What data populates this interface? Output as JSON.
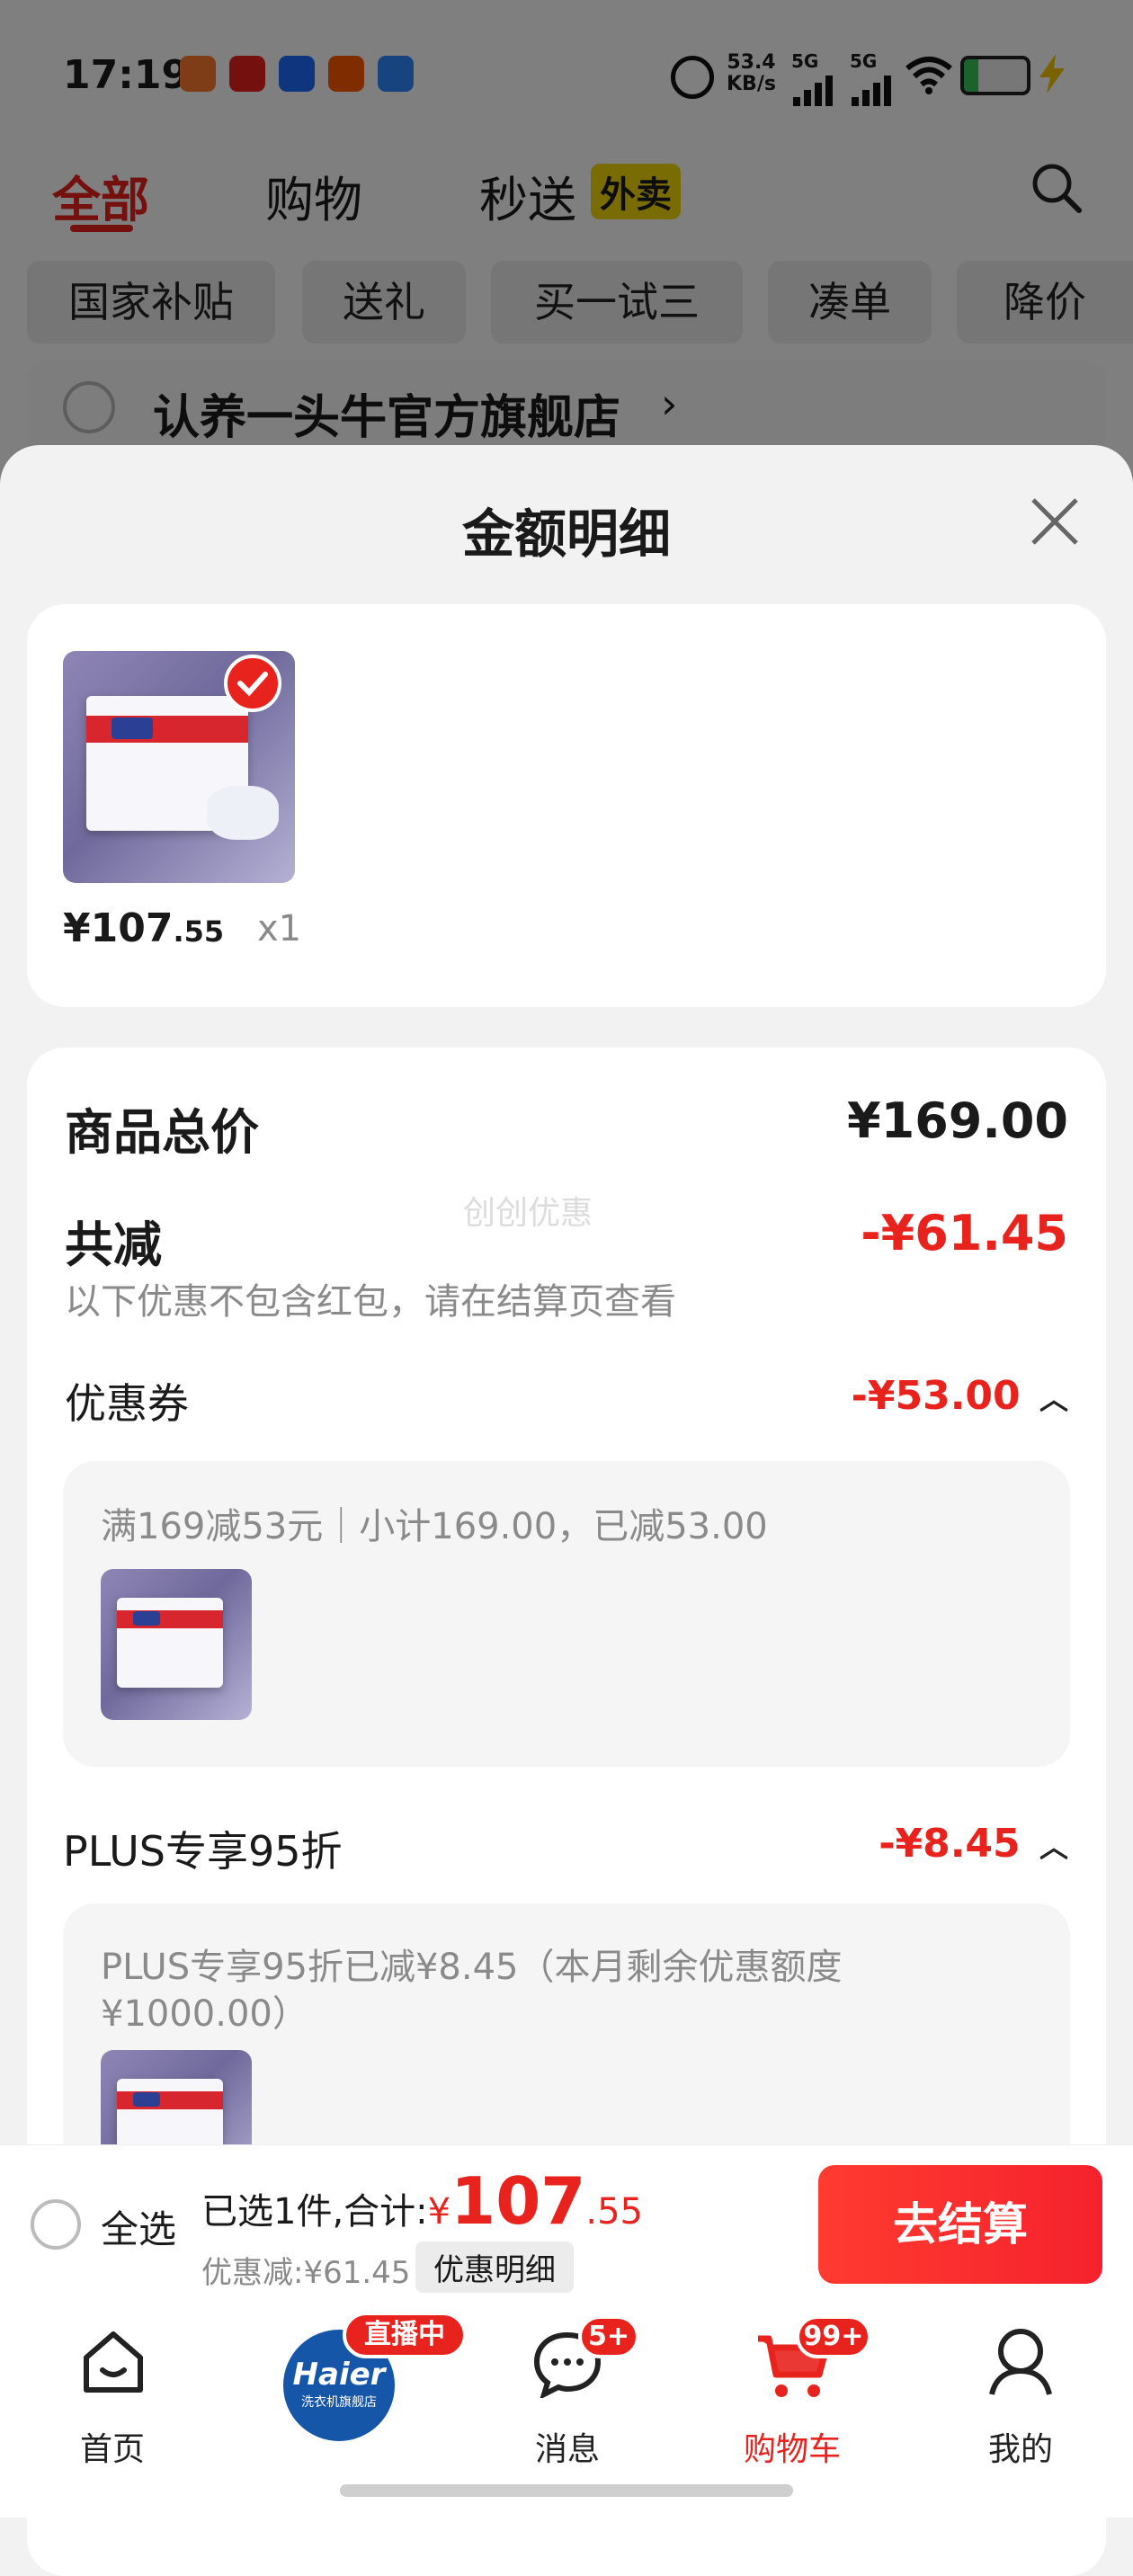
{
  "status_bar": {
    "time": "17:19",
    "net_speed_value": "53.4",
    "net_speed_unit": "KB/s",
    "signal1": "5G",
    "signal2": "5G"
  },
  "top_tabs": [
    {
      "label": "全部"
    },
    {
      "label": "购物"
    },
    {
      "label": "秒送"
    }
  ],
  "takeout_badge": "外卖",
  "filter_chips": [
    "国家补贴",
    "送礼",
    "买一试三",
    "凑单",
    "降价"
  ],
  "store": {
    "name": "认养一头牛官方旗舰店",
    "arrow": "›"
  },
  "sheet": {
    "title": "金额明细",
    "item": {
      "price_main": "¥107",
      "price_dec": ".55",
      "qty": "x1"
    },
    "total_label": "商品总价",
    "total_value": "¥169.00",
    "reduce_label": "共减",
    "reduce_value": "-¥61.45",
    "watermark": "创创优惠",
    "note": "以下优惠不包含红包，请在结算页查看",
    "coupon_label": "优惠券",
    "coupon_value": "-¥53.00",
    "coupon_detail": "满169减53元｜小计169.00，已减53.00",
    "plus_label": "PLUS专享95折",
    "plus_value": "-¥8.45",
    "plus_detail_line1": "PLUS专享95折已减¥8.45（本月剩余优惠额度",
    "plus_detail_line2": "¥1000.00）"
  },
  "checkout": {
    "select_all": "全选",
    "selected_text": "已选1件,合计:",
    "currency": "¥",
    "amount_main": "107",
    "amount_dec": ".55",
    "discount_text": "优惠减:¥61.45",
    "detail_button": "优惠明细",
    "checkout_button": "去结算"
  },
  "bottom_nav": {
    "home": "首页",
    "live_badge": "直播中",
    "live_brand": "Haier",
    "live_sub": "洗衣机旗舰店",
    "messages": "消息",
    "messages_badge": "5+",
    "cart": "购物车",
    "cart_badge": "99+",
    "me": "我的"
  },
  "colors": {
    "accent_red": "#e8231e",
    "checkout_red": "#f5222d",
    "takeout_yellow": "#f5d90a"
  }
}
